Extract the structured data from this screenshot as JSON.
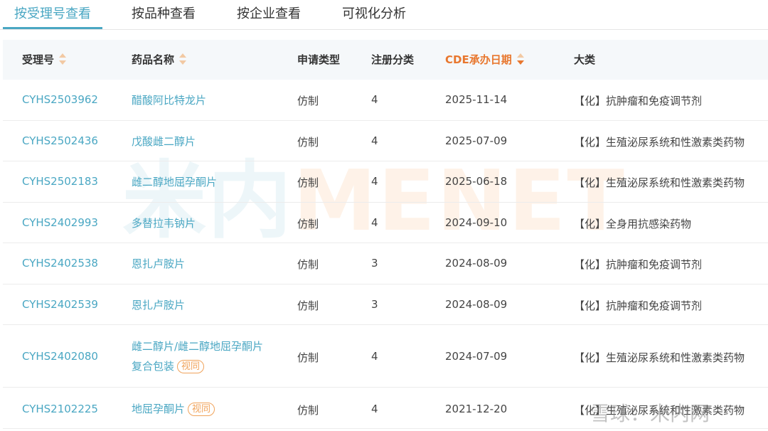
{
  "tabs": [
    {
      "label": "按受理号查看",
      "active": true
    },
    {
      "label": "按品种查看",
      "active": false
    },
    {
      "label": "按企业查看",
      "active": false
    },
    {
      "label": "可视化分析",
      "active": false
    }
  ],
  "table": {
    "headers": {
      "acceptance_no": "受理号",
      "drug_name": "药品名称",
      "application_type": "申请类型",
      "registration_class": "注册分类",
      "cde_date": "CDE承办日期",
      "category": "大类"
    },
    "sort_indicators": {
      "acceptance_no": "both",
      "drug_name": "both",
      "cde_date": "desc-active"
    },
    "colors": {
      "link": "#4aa7c3",
      "active_sort": "#e8772e",
      "badge": "#f0a35b"
    },
    "rows": [
      {
        "acceptance_no": "CYHS2503962",
        "drug_name": "醋酸阿比特龙片",
        "drug_name_line2": "",
        "badge": "",
        "application_type": "仿制",
        "registration_class": "4",
        "cde_date": "2025-11-14",
        "category": "【化】抗肿瘤和免疫调节剂"
      },
      {
        "acceptance_no": "CYHS2502436",
        "drug_name": "戊酸雌二醇片",
        "drug_name_line2": "",
        "badge": "",
        "application_type": "仿制",
        "registration_class": "4",
        "cde_date": "2025-07-09",
        "category": "【化】生殖泌尿系统和性激素类药物"
      },
      {
        "acceptance_no": "CYHS2502183",
        "drug_name": "雌二醇地屈孕酮片",
        "drug_name_line2": "",
        "badge": "",
        "application_type": "仿制",
        "registration_class": "4",
        "cde_date": "2025-06-18",
        "category": "【化】生殖泌尿系统和性激素类药物"
      },
      {
        "acceptance_no": "CYHS2402993",
        "drug_name": "多替拉韦钠片",
        "drug_name_line2": "",
        "badge": "",
        "application_type": "仿制",
        "registration_class": "4",
        "cde_date": "2024-09-10",
        "category": "【化】全身用抗感染药物"
      },
      {
        "acceptance_no": "CYHS2402538",
        "drug_name": "恩扎卢胺片",
        "drug_name_line2": "",
        "badge": "",
        "application_type": "仿制",
        "registration_class": "3",
        "cde_date": "2024-08-09",
        "category": "【化】抗肿瘤和免疫调节剂"
      },
      {
        "acceptance_no": "CYHS2402539",
        "drug_name": "恩扎卢胺片",
        "drug_name_line2": "",
        "badge": "",
        "application_type": "仿制",
        "registration_class": "3",
        "cde_date": "2024-08-09",
        "category": "【化】抗肿瘤和免疫调节剂"
      },
      {
        "acceptance_no": "CYHS2402080",
        "drug_name": "雌二醇片/雌二醇地屈孕酮片",
        "drug_name_line2": "复合包装",
        "badge": "视同",
        "application_type": "仿制",
        "registration_class": "4",
        "cde_date": "2024-07-09",
        "category": "【化】生殖泌尿系统和性激素类药物"
      },
      {
        "acceptance_no": "CYHS2102225",
        "drug_name": "地屈孕酮片",
        "drug_name_line2": "",
        "badge": "视同",
        "application_type": "仿制",
        "registration_class": "4",
        "cde_date": "2021-12-20",
        "category": "【化】生殖泌尿系统和性激素类药物"
      }
    ]
  },
  "watermark": {
    "cn": "米内",
    "en": "MENET"
  },
  "footer_mark": "雪球：米内网"
}
